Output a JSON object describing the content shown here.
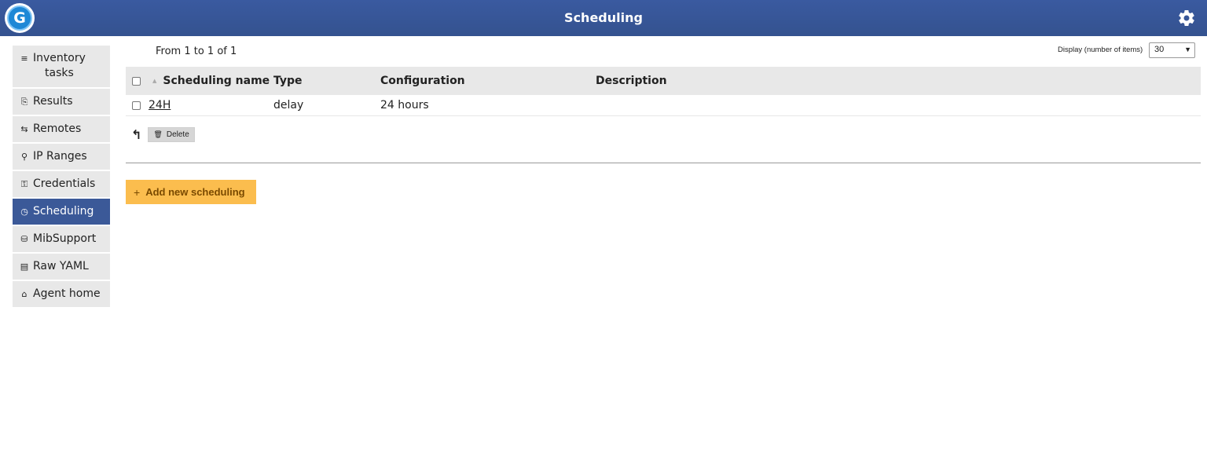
{
  "header": {
    "title": "Scheduling",
    "logo_letter": "G"
  },
  "sidebar": {
    "items": [
      {
        "icon": "≡",
        "label": "Inventory tasks",
        "line1": "Inventory",
        "line2": "tasks"
      },
      {
        "icon": "⎘",
        "label": "Results"
      },
      {
        "icon": "⇆",
        "label": "Remotes"
      },
      {
        "icon": "⚲",
        "label": "IP Ranges"
      },
      {
        "icon": "⚿",
        "label": "Credentials"
      },
      {
        "icon": "◷",
        "label": "Scheduling"
      },
      {
        "icon": "⛁",
        "label": "MibSupport"
      },
      {
        "icon": "▤",
        "label": "Raw YAML"
      },
      {
        "icon": "⌂",
        "label": "Agent home"
      }
    ]
  },
  "pager": {
    "text": "From 1 to 1 of 1"
  },
  "display": {
    "label": "Display (number of items)",
    "value": "30"
  },
  "table": {
    "headers": {
      "name": "Scheduling name",
      "type": "Type",
      "configuration": "Configuration",
      "description": "Description"
    },
    "rows": [
      {
        "name": "24H",
        "type": "delay",
        "configuration": "24 hours",
        "description": ""
      }
    ]
  },
  "bulk": {
    "delete_label": "Delete"
  },
  "actions": {
    "add_label": "Add new scheduling"
  },
  "colors": {
    "header_bg": "#3b5998",
    "active_nav_bg": "#3b5998",
    "nav_bg": "#e8e8e8",
    "add_button_bg": "#fbbd4e"
  }
}
